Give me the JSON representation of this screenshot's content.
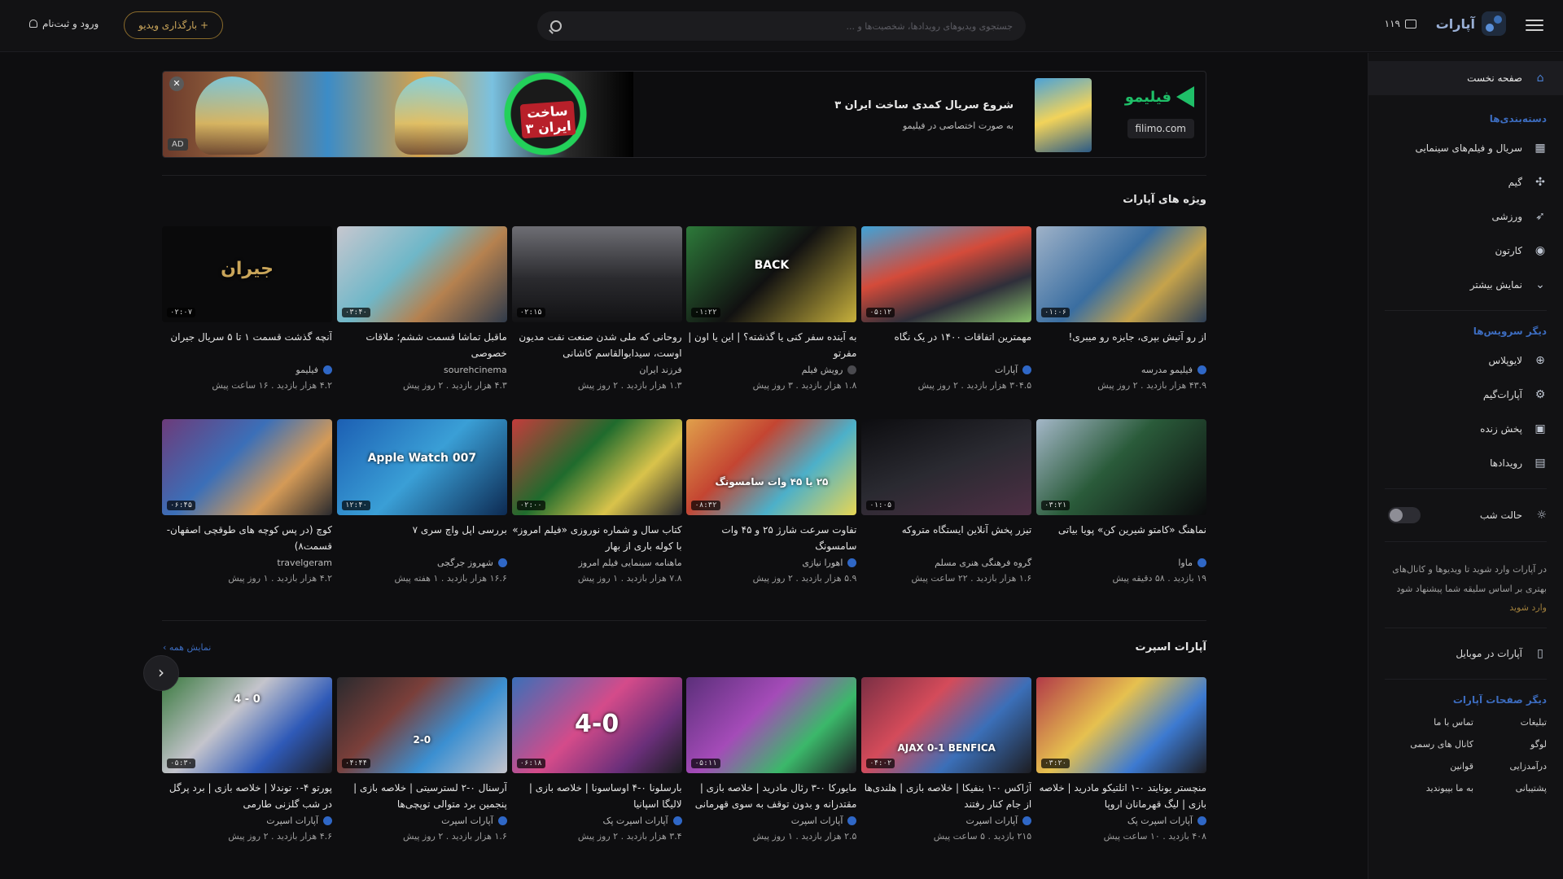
{
  "header": {
    "notifications_count": "۱۱۹",
    "search_placeholder": "جستجوی ویدیوهای رویدادها، شخصیت‌ها و ...",
    "upload_label": "+ بارگذاری ویدیو",
    "login_label": "ورود و ثبت‌نام"
  },
  "sidebar": {
    "home": "صفحه نخست",
    "categories_title": "دسته‌بندی‌ها",
    "categories": [
      "سریال و فیلم‌های سینمایی",
      "گیم",
      "ورزشی",
      "کارتون",
      "نمایش بیشتر"
    ],
    "services_title": "دیگر سرویس‌ها",
    "services": [
      "لایوپلاس",
      "آپارات‌گیم",
      "پخش زنده",
      "رویدادها"
    ],
    "night_mode": "حالت شب",
    "login_note": "در آپارات وارد شوید تا ویدیوها و کانال‌های بهتری بر اساس سلیقه شما پیشنهاد شود",
    "login_link": "وارد شوید",
    "mobile": "آپارات در موبایل",
    "pages_title": "دیگر صفحات آپارات",
    "pages": [
      "تبلیغات",
      "تماس با ما",
      "لوگو",
      "کانال های رسمی",
      "درآمدزایی",
      "قوانین",
      "پشتیبانی",
      "به ما بپیوندید"
    ]
  },
  "ad": {
    "brand": "فیلیمو",
    "link": "filimo.com",
    "title": "شروع سریال کمدی ساخت ایران ۳",
    "subtitle": "به صورت اختصاصی در فیلیمو",
    "badge": "AD",
    "logo_text": "ساخت ایران ۳"
  },
  "featured": {
    "title": "ویژه های آپارات",
    "row1": [
      {
        "title": "از رو آتیش بپری، جایزه رو میبری!",
        "channel": "فیلیمو مدرسه",
        "views": "۴۳.۹ هزار بازدید",
        "time": "۲ روز پیش",
        "duration": "۰۱:۰۶"
      },
      {
        "title": "مهمترین اتفاقات ۱۴۰۰ در یک نگاه",
        "channel": "آپارات",
        "views": "۳۰۴.۵ هزار بازدید",
        "time": "۲ روز پیش",
        "duration": "۰۵:۱۲"
      },
      {
        "title": "به آینده سفر کنی یا گذشته؟ | این یا اون | مفرتو",
        "channel": "رویش فیلم",
        "views": "۱.۸ هزار بازدید",
        "time": "۳ روز پیش",
        "duration": "۰۱:۲۲",
        "overlay": "BACK"
      },
      {
        "title": "روحانی که ملی شدن صنعت نفت مدیون اوست، سیدابوالقاسم کاشانی",
        "channel": "فرزند ایران",
        "views": "۱.۳ هزار بازدید",
        "time": "۲ روز پیش",
        "duration": "۰۲:۱۵"
      },
      {
        "title": "ماقبل تماشا قسمت ششم؛ ملاقات خصوصی",
        "channel": "sourehcinema",
        "views": "۴.۳ هزار بازدید",
        "time": "۲ روز پیش",
        "duration": "۰۳:۴۰"
      },
      {
        "title": "آنچه گذشت قسمت ۱ تا ۵ سریال جیران",
        "channel": "فیلیمو",
        "views": "۴.۲ هزار بازدید",
        "time": "۱۶ ساعت پیش",
        "duration": "۰۲:۰۷",
        "overlay": "جیران"
      }
    ],
    "row2": [
      {
        "title": "نماهنگ «کامتو شیرین کن» پویا بیاتی",
        "channel": "ماوا",
        "views": "۱۹ بازدید",
        "time": "۵۸ دقیقه پیش",
        "duration": "۰۳:۲۱"
      },
      {
        "title": "تیزر پخش آنلاین ایستگاه متروکه",
        "channel": "گروه فرهنگی هنری مسلم",
        "views": "۱.۶ هزار بازدید",
        "time": "۲۲ ساعت پیش",
        "duration": "۰۱:۰۵"
      },
      {
        "title": "تفاوت سرعت شارژ ۲۵ و ۴۵ وات سامسونگ",
        "channel": "اهورا نیازی",
        "views": "۵.۹ هزار بازدید",
        "time": "۲ روز پیش",
        "duration": "۰۸:۳۲",
        "overlay": "۲۵ یا ۴۵ وات سامسونگ"
      },
      {
        "title": "کتاب سال و شماره نوروزی «فیلم امروز» با کوله باری از بهار",
        "channel": "ماهنامه سینمایی فیلم امروز",
        "views": "۷.۸ هزار بازدید",
        "time": "۱ روز پیش",
        "duration": "۰۲:۰۰"
      },
      {
        "title": "بررسی اپل واچ سری ۷",
        "channel": "شهروز جرگجی",
        "views": "۱۶.۶ هزار بازدید",
        "time": "۱ هفته پیش",
        "duration": "۱۲:۴۰",
        "overlay": "Apple Watch 007"
      },
      {
        "title": "کوچ (در پس کوچه های طوقچی اصفهان-قسمت۸)",
        "channel": "travelgeram",
        "views": "۴.۲ هزار بازدید",
        "time": "۱ روز پیش",
        "duration": "۰۶:۴۵"
      }
    ]
  },
  "sport": {
    "title": "آپارات اسپرت",
    "see_all": "نمایش همه ›",
    "items": [
      {
        "title": "منچستر یونایتد ۰-۱ اتلتیکو مادرید | خلاصه بازی | لیگ قهرمانان اروپا",
        "channel": "آپارات اسپرت پک",
        "views": "۴۰۸ بازدید",
        "time": "۱۰ ساعت پیش",
        "duration": "۰۳:۲۰"
      },
      {
        "title": "آژاکس ۰-۱ بنفیکا | خلاصه بازی | هلندی‌ها از جام کنار رفتند",
        "channel": "آپارات اسپرت",
        "views": "۲۱۵ بازدید",
        "time": "۵ ساعت پیش",
        "duration": "۰۴:۰۲",
        "overlay": "AJAX 0-1 BENFICA"
      },
      {
        "title": "مایورکا ۰-۳ رئال مادرید | خلاصه بازی | مقتدرانه و بدون توقف به سوی قهرمانی",
        "channel": "آپارات اسپرت",
        "views": "۲.۵ هزار بازدید",
        "time": "۱ روز پیش",
        "duration": "۰۵:۱۱"
      },
      {
        "title": "بارسلونا ۰-۴ اوساسونا | خلاصه بازی | لالیگا اسپانیا",
        "channel": "آپارات اسپرت پک",
        "views": "۳.۴ هزار بازدید",
        "time": "۲ روز پیش",
        "duration": "۰۶:۱۸",
        "overlay": "4-0"
      },
      {
        "title": "آرسنال ۰-۲ لسترسیتی | خلاصه بازی | پنجمین برد متوالی توپچی‌ها",
        "channel": "آپارات اسپرت",
        "views": "۱.۶ هزار بازدید",
        "time": "۲ روز پیش",
        "duration": "۰۴:۴۴",
        "overlay": "2-0"
      },
      {
        "title": "پورتو ۴-۰ توندلا | خلاصه بازی | برد پرگل در شب گلزنی طارمی",
        "channel": "آپارات اسپرت",
        "views": "۴.۶ هزار بازدید",
        "time": "۲ روز پیش",
        "duration": "۰۵:۳۰",
        "overlay": "4 - 0"
      }
    ]
  }
}
